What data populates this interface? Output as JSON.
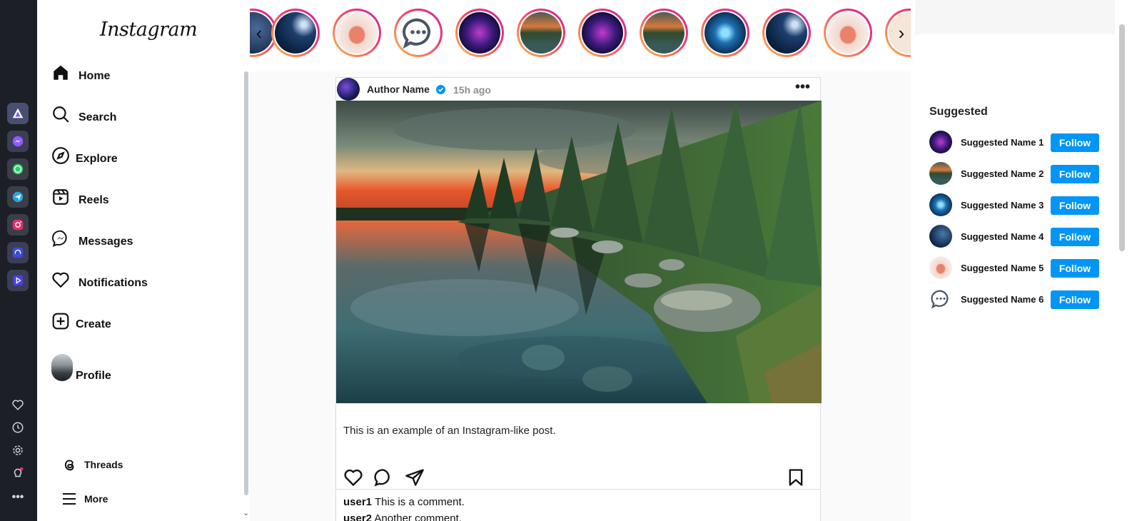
{
  "dock": {
    "apps": [
      {
        "icon": "arc-icon",
        "color": "#6b4fd8"
      },
      {
        "icon": "messenger-icon",
        "color": "#8a4dff"
      },
      {
        "icon": "whatsapp-icon",
        "color": "#25d366"
      },
      {
        "icon": "telegram-icon",
        "color": "#2aa3e0"
      },
      {
        "icon": "instagram-icon",
        "color": "#e1306c"
      },
      {
        "icon": "headphones-icon",
        "color": "#3a4bd6"
      },
      {
        "icon": "play-icon",
        "color": "#4b3de0"
      }
    ],
    "tools": [
      "heart-icon",
      "clock-icon",
      "gear-icon",
      "bulb-icon",
      "more-dots-icon"
    ]
  },
  "nav": {
    "logo": "Instagram",
    "items": [
      {
        "label": "Home",
        "icon": "home-icon"
      },
      {
        "label": "Search",
        "icon": "search-icon"
      },
      {
        "label": "Explore",
        "icon": "compass-icon"
      },
      {
        "label": "Reels",
        "icon": "reels-icon"
      },
      {
        "label": "Messages",
        "icon": "messenger-icon"
      },
      {
        "label": "Notifications",
        "icon": "heart-icon"
      },
      {
        "label": "Create",
        "icon": "plus-square-icon"
      },
      {
        "label": "Profile",
        "icon": "avatar"
      }
    ],
    "threads": "Threads",
    "more": "More"
  },
  "stories": {
    "count_visible": 11
  },
  "post": {
    "author": "Author Name",
    "time": "15h ago",
    "menu": "•••",
    "caption": "This is an example of an Instagram-like post.",
    "comments": [
      {
        "user": "user1",
        "text": "This is a comment."
      },
      {
        "user": "user2",
        "text": "Another comment."
      }
    ]
  },
  "suggested": {
    "title": "Suggested",
    "follow_label": "Follow",
    "items": [
      {
        "name": "Suggested Name 1"
      },
      {
        "name": "Suggested Name 2"
      },
      {
        "name": "Suggested Name 3"
      },
      {
        "name": "Suggested Name 4"
      },
      {
        "name": "Suggested Name 5"
      },
      {
        "name": "Suggested Name 6"
      }
    ]
  },
  "colors": {
    "accent": "#0095f6",
    "story_ring_start": "#f9c04a",
    "story_ring_end": "#c32aa3"
  }
}
